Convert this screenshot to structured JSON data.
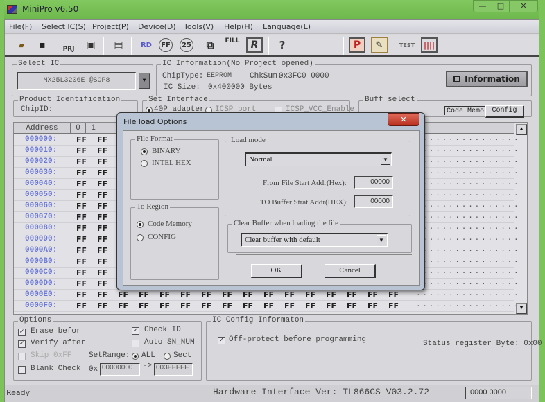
{
  "window": {
    "title": "MiniPro v6.50",
    "controls": {
      "minimize": "—",
      "maximize": "□",
      "close": "✕"
    }
  },
  "menu": [
    {
      "label": "File(F)"
    },
    {
      "label": "Select IC(S)"
    },
    {
      "label": "Project(P)"
    },
    {
      "label": "Device(D)"
    },
    {
      "label": "Tools(V)"
    },
    {
      "label": "Help(H)"
    },
    {
      "label": "Language(L)"
    }
  ],
  "toolbar": [
    {
      "icon": "open-folder-icon",
      "glyph": "📂"
    },
    {
      "icon": "save-icon",
      "glyph": "💾"
    },
    {
      "icon": "open-project-icon",
      "glyph": "PRJ"
    },
    {
      "icon": "save-project-icon",
      "glyph": "▣"
    },
    {
      "icon": "chip-save-icon",
      "glyph": "▤"
    },
    {
      "icon": "read-device-icon",
      "glyph": "RD"
    },
    {
      "icon": "blank-check-icon",
      "glyph": "FF"
    },
    {
      "icon": "verify-icon",
      "glyph": "25"
    },
    {
      "icon": "copy-chip-icon",
      "glyph": "⧉"
    },
    {
      "icon": "fill-icon",
      "glyph": "FILL"
    },
    {
      "icon": "register-icon",
      "glyph": "R"
    },
    {
      "icon": "help-icon",
      "glyph": "?"
    },
    {
      "icon": "program-icon",
      "glyph": "P"
    },
    {
      "icon": "edit-icon",
      "glyph": "✎"
    },
    {
      "icon": "test-icon",
      "glyph": "TEST"
    },
    {
      "icon": "ic-test-icon",
      "glyph": "||||"
    }
  ],
  "select_ic": {
    "label": "Select IC",
    "value": "MX25L3206E @SOP8"
  },
  "ic_info": {
    "label": "IC Information(No Project opened)",
    "chip_type_label": "ChipType:",
    "chip_type": "EEPROM",
    "checksum_label": "ChkSum:",
    "checksum": "0x3FC0 0000",
    "ic_size_label": "IC Size:",
    "ic_size": "0x400000 Bytes",
    "info_button": "Information"
  },
  "product_id": {
    "label": "Product Identification",
    "chip_id_label": "ChipID:"
  },
  "set_interface": {
    "label": "Set Interface",
    "options": [
      "40P adapter",
      "ICSP port"
    ],
    "selected": "40P adapter",
    "icsp_vcc": "ICSP_VCC_Enable"
  },
  "buff_select": {
    "label": "Buff select",
    "tabs": [
      "Code Memo",
      "Config"
    ],
    "active": "Code Memo"
  },
  "hex_view": {
    "header": {
      "address": "Address",
      "cols": [
        "0",
        "1"
      ]
    },
    "rows": [
      {
        "addr": "000000:",
        "bytes": "FF"
      },
      {
        "addr": "000010:",
        "bytes": "FF"
      },
      {
        "addr": "000020:",
        "bytes": "FF"
      },
      {
        "addr": "000030:",
        "bytes": "FF"
      },
      {
        "addr": "000040:",
        "bytes": "FF"
      },
      {
        "addr": "000050:",
        "bytes": "FF"
      },
      {
        "addr": "000060:",
        "bytes": "FF"
      },
      {
        "addr": "000070:",
        "bytes": "FF"
      },
      {
        "addr": "000080:",
        "bytes": "FF"
      },
      {
        "addr": "000090:",
        "bytes": "FF"
      },
      {
        "addr": "0000A0:",
        "bytes": "FF"
      },
      {
        "addr": "0000B0:",
        "bytes": "FF"
      },
      {
        "addr": "0000C0:",
        "bytes": "FF"
      },
      {
        "addr": "0000D0:",
        "bytes": "FF"
      },
      {
        "addr": "0000E0:",
        "bytes": "FF"
      },
      {
        "addr": "0000F0:",
        "bytes": "FF"
      }
    ],
    "ascii": "................"
  },
  "options": {
    "label": "Options",
    "erase_before": {
      "label": "Erase befor",
      "checked": true
    },
    "verify_after": {
      "label": "Verify after",
      "checked": true
    },
    "skip_0xff": {
      "label": "Skip 0xFF",
      "checked": false,
      "disabled": true
    },
    "blank_check": {
      "label": "Blank Check",
      "checked": false
    },
    "check_id": {
      "label": "Check ID",
      "checked": true
    },
    "auto_sn": {
      "label": "Auto SN_NUM",
      "checked": false
    },
    "set_range_label": "SetRange:",
    "range_all": "ALL",
    "range_sect": "Sect",
    "range_selected": "ALL",
    "hex_prefix": "0x",
    "range_from": "00000000",
    "range_arrow": "->",
    "range_to": "003FFFFF"
  },
  "ic_config": {
    "label": "IC Config Informaton",
    "off_protect": {
      "label": "Off-protect before programming",
      "checked": true
    },
    "status_register": "Status register Byte: 0x00"
  },
  "statusbar": {
    "ready": "Ready",
    "hardware": "Hardware Interface Ver: TL866CS V03.2.72",
    "counter": "0000 0000"
  },
  "dialog": {
    "title": "File load Options",
    "close": "✕",
    "file_format": {
      "label": "File Format",
      "options": [
        "BINARY",
        "INTEL HEX"
      ],
      "selected": "BINARY"
    },
    "to_region": {
      "label": "To Region",
      "options": [
        "Code Memory",
        "CONFIG"
      ],
      "selected": "Code Memory"
    },
    "load_mode": {
      "label": "Load mode",
      "value": "Normal",
      "from_label": "From File Start Addr(Hex):",
      "from_value": "00000",
      "to_label": "TO Buffer Strat Addr(HEX):",
      "to_value": "00000"
    },
    "clear_buffer": {
      "label": "Clear Buffer when loading the file",
      "value": "Clear buffer with default"
    },
    "ok": "OK",
    "cancel": "Cancel"
  }
}
